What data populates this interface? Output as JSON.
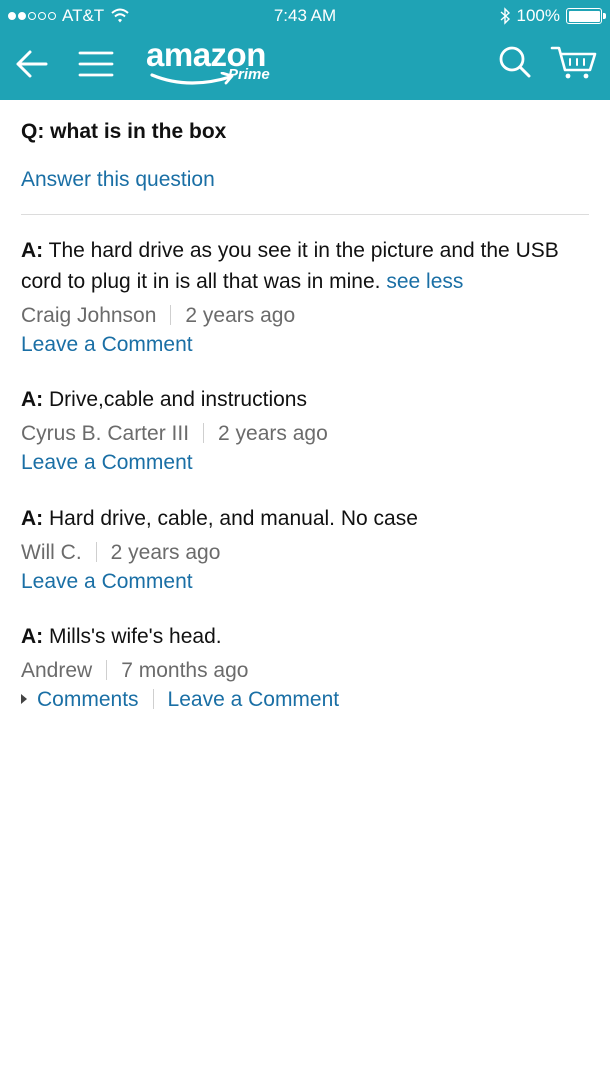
{
  "status": {
    "carrier": "AT&T",
    "time": "7:43 AM",
    "battery": "100%",
    "signal_bars_filled": 2,
    "signal_bars_total": 5
  },
  "header": {
    "logo_word": "amazon",
    "logo_sub": "Prime",
    "background_color": "#1fa3b5"
  },
  "question": {
    "text": "Q: what is in the box",
    "answer_link": "Answer this question"
  },
  "answers": [
    {
      "label": "A:",
      "text": " The hard drive as you see it in the picture and the USB cord to plug it in is all that was in mine.",
      "see_less": "see less",
      "author": "Craig Johnson",
      "date": "2 years ago",
      "comment_link": "Leave a Comment"
    },
    {
      "label": "A:",
      "text": " Drive,cable and instructions",
      "author": "Cyrus B. Carter III",
      "date": "2 years ago",
      "comment_link": "Leave a Comment"
    },
    {
      "label": "A:",
      "text": " Hard drive, cable, and manual. No case",
      "author": "Will C.",
      "date": "2 years ago",
      "comment_link": "Leave a Comment"
    },
    {
      "label": "A:",
      "text": " Mills's wife's head.",
      "author": "Andrew",
      "date": "7 months ago",
      "comments_link": "Comments",
      "comment_link": "Leave a Comment"
    }
  ],
  "link_color": "#1a6fa5"
}
